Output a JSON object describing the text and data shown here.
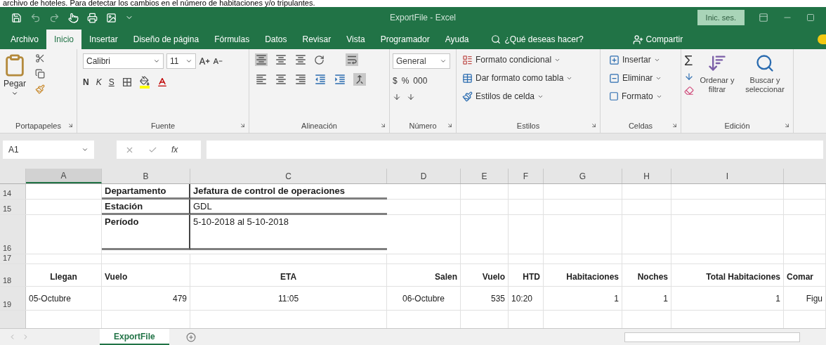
{
  "caption": "archivo de hoteles. Para detectar los cambios en el número de habitaciones y/o tripulantes.",
  "title_bar": {
    "title": "ExportFile - Excel",
    "sign_in": "Inic. ses."
  },
  "tabs": [
    {
      "label": "Archivo",
      "selected": false
    },
    {
      "label": "Inicio",
      "selected": true
    },
    {
      "label": "Insertar",
      "selected": false
    },
    {
      "label": "Diseño de página",
      "selected": false
    },
    {
      "label": "Fórmulas",
      "selected": false
    },
    {
      "label": "Datos",
      "selected": false
    },
    {
      "label": "Revisar",
      "selected": false
    },
    {
      "label": "Vista",
      "selected": false
    },
    {
      "label": "Programador",
      "selected": false
    },
    {
      "label": "Ayuda",
      "selected": false
    }
  ],
  "tell_me": "¿Qué deseas hacer?",
  "share": "Compartir",
  "ribbon": {
    "clipboard": {
      "paste": "Pegar",
      "label": "Portapapeles"
    },
    "font": {
      "name": "Calibri",
      "size": "11",
      "bold": "N",
      "italic": "K",
      "underline": "S",
      "label": "Fuente"
    },
    "alignment": {
      "label": "Alineación"
    },
    "number": {
      "format": "General",
      "currency": "$",
      "percent": "%",
      "thousands": "000",
      "label": "Número"
    },
    "styles": {
      "items": [
        "Formato condicional",
        "Dar formato como tabla",
        "Estilos de celda"
      ],
      "label": "Estilos"
    },
    "cells": {
      "items": [
        "Insertar",
        "Eliminar",
        "Formato"
      ],
      "label": "Celdas"
    },
    "editing": {
      "autosum": "Σ",
      "sort": "Ordenar y filtrar",
      "find": "Buscar y seleccionar",
      "label": "Edición"
    }
  },
  "formula_bar": {
    "name_box": "A1",
    "fx": "fx"
  },
  "columns": [
    "A",
    "B",
    "C",
    "D",
    "E",
    "F",
    "G",
    "H",
    "I"
  ],
  "rows": [
    {
      "number": "14",
      "kind": "info",
      "label": "Departamento",
      "value": "Jefatura de control de operaciones",
      "value_bold": true
    },
    {
      "number": "15",
      "kind": "info",
      "label": "Estación",
      "value": "GDL",
      "value_bold": false
    },
    {
      "number": "16",
      "kind": "info",
      "label": "Período",
      "value": "5-10-2018 al 5-10-2018",
      "value_bold": false
    },
    {
      "number": "17",
      "kind": "empty"
    },
    {
      "number": "18",
      "kind": "header",
      "cells": [
        "Llegan",
        "Vuelo",
        "ETA",
        "Salen",
        "Vuelo",
        "HTD",
        "Habitaciones",
        "Noches",
        "Total Habitaciones",
        "Comar"
      ]
    },
    {
      "number": "19",
      "kind": "data",
      "cells": [
        "05-Octubre",
        "479",
        "11:05",
        "06-Octubre",
        "535",
        "10:20",
        "1",
        "1",
        "1",
        "Figu"
      ]
    }
  ],
  "sheet_tabs": [
    {
      "label": "ExportFile",
      "selected": true
    }
  ]
}
